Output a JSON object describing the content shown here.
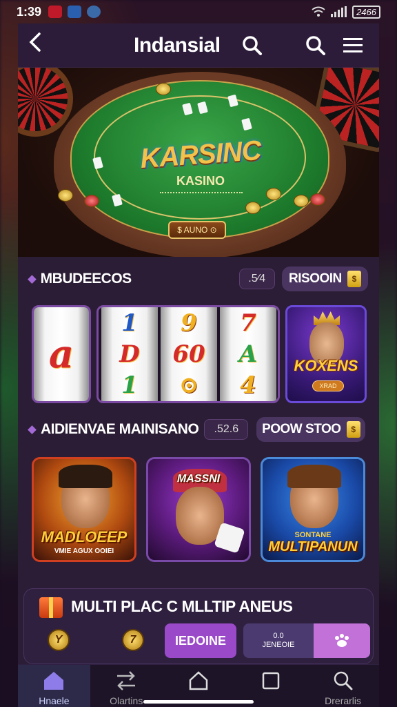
{
  "status_bar": {
    "time": "1:39",
    "battery": "2466"
  },
  "header": {
    "back_icon": "chevron-left-icon",
    "title": "Indansial",
    "search_icon": "search-icon",
    "menu_icon": "menu-icon"
  },
  "hero": {
    "logo_text": "KARSINC",
    "logo_sub": "KASINO",
    "button_label": "$ AUNO ⊙"
  },
  "section1": {
    "label": "MBUDEECOS",
    "value_pill": ".5⁄4",
    "action_label": "RISOOIN",
    "action_icon": "coin-badge-icon"
  },
  "slots": {
    "single_reel": [
      "a"
    ],
    "reel1": [
      "1",
      "D",
      "1"
    ],
    "reel2": [
      "9",
      "60",
      "⊙"
    ],
    "reel3": [
      "7",
      "A",
      "4"
    ],
    "kings": {
      "title": "KOXENS",
      "button": "XRAD"
    }
  },
  "section2": {
    "label": "AIDIENVAE MAINISANO",
    "value_pill": ".52.6",
    "action_label": "POOW STOO",
    "action_icon": "coin-badge-icon"
  },
  "games": [
    {
      "title": "MADLOEEP",
      "subtitle": "VMIE AGUX  OOIEI"
    },
    {
      "title": "MASSNI",
      "subtitle": ""
    },
    {
      "title": "MULTIPANUN",
      "subtitle": "SONTANE"
    }
  ],
  "multi": {
    "title": "MULTI PLAC C MLLTIP ANEUS",
    "coin1": "Y",
    "coin2": "7",
    "primary_button": "IEDOINE",
    "seg_a_line1": "0.0",
    "seg_a_line2": "JENEOIE",
    "seg_b_icon": "paw-icon"
  },
  "bottom_nav": [
    {
      "label": "Hnaele",
      "icon": "home-icon",
      "active": true
    },
    {
      "label": "Olartins",
      "icon": "swap-icon",
      "active": false
    },
    {
      "label": "",
      "icon": "home-outline-icon",
      "active": false
    },
    {
      "label": "",
      "icon": "square-icon",
      "active": false
    },
    {
      "label": "Drerarlis",
      "icon": "search-icon",
      "active": false
    }
  ],
  "colors": {
    "accent": "#9a4ac8",
    "panel": "#2b1d35",
    "active_nav": "#2c2a48"
  }
}
